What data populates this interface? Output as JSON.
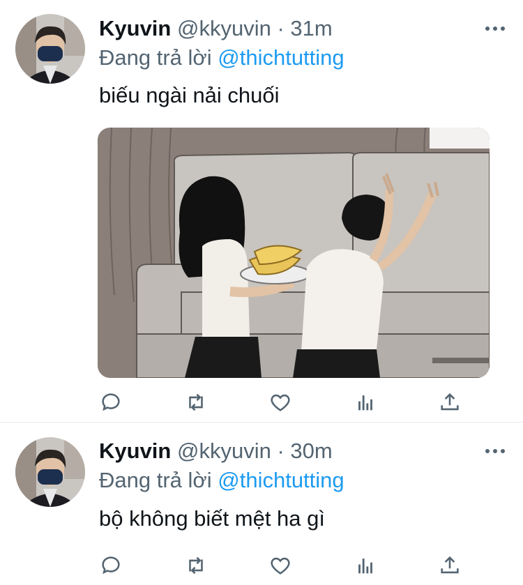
{
  "tweets": [
    {
      "name": "Kyuvin",
      "handle": "@kkyuvin",
      "separator": "·",
      "time": "31m",
      "replying_prefix": "Đang trả lời",
      "replying_to": "@thichtutting",
      "text": "biếu ngài nải chuối",
      "has_media": true
    },
    {
      "name": "Kyuvin",
      "handle": "@kkyuvin",
      "separator": "·",
      "time": "30m",
      "replying_prefix": "Đang trả lời",
      "replying_to": "@thichtutting",
      "text": "bộ không biết mệt ha gì",
      "has_media": false
    }
  ],
  "colors": {
    "text": "#0f1419",
    "secondary": "#536471",
    "accent": "#1d9bf0",
    "divider": "#e6ecf0"
  },
  "icons": [
    "more-icon",
    "reply-icon",
    "retweet-icon",
    "like-icon",
    "analytics-icon",
    "share-icon"
  ]
}
